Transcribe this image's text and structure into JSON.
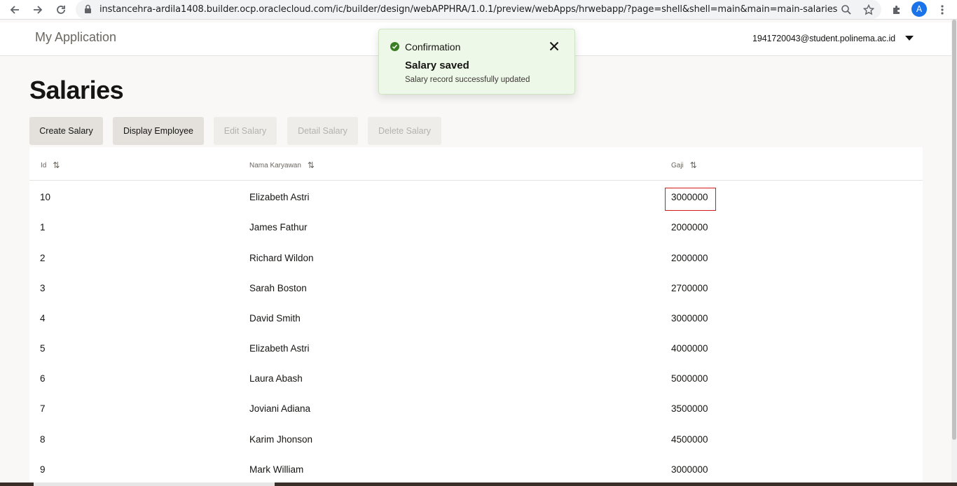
{
  "browser": {
    "url": "instancehra-ardila1408.builder.ocp.oraclecloud.com/ic/builder/design/webAPPHRA/1.0.1/preview/webApps/hrwebapp/?page=shell&shell=main&main=main-salaries",
    "profile_initial": "A"
  },
  "header": {
    "app_title": "My Application",
    "user_email": "1941720043@student.polinema.ac.id"
  },
  "page": {
    "title": "Salaries"
  },
  "toolbar": {
    "create_label": "Create Salary",
    "display_label": "Display Employee",
    "edit_label": "Edit Salary",
    "detail_label": "Detail Salary",
    "delete_label": "Delete Salary"
  },
  "table": {
    "columns": [
      "Id",
      "Nama Karyawan",
      "Gaji"
    ],
    "rows": [
      {
        "id": "10",
        "nama": "Elizabeth Astri",
        "gaji": "3000000"
      },
      {
        "id": "1",
        "nama": "James Fathur",
        "gaji": "2000000"
      },
      {
        "id": "2",
        "nama": "Richard Wildon",
        "gaji": "2000000"
      },
      {
        "id": "3",
        "nama": "Sarah Boston",
        "gaji": "2700000"
      },
      {
        "id": "4",
        "nama": "David Smith",
        "gaji": "3000000"
      },
      {
        "id": "5",
        "nama": "Elizabeth Astri",
        "gaji": "4000000"
      },
      {
        "id": "6",
        "nama": "Laura Abash",
        "gaji": "5000000"
      },
      {
        "id": "7",
        "nama": "Joviani Adiana",
        "gaji": "3500000"
      },
      {
        "id": "8",
        "nama": "Karim Jhonson",
        "gaji": "4500000"
      },
      {
        "id": "9",
        "nama": "Mark William",
        "gaji": "3000000"
      }
    ]
  },
  "toast": {
    "category": "Confirmation",
    "summary": "Salary saved",
    "detail": "Salary record successfully updated"
  },
  "colors": {
    "confirmation_green": "#3b7d23",
    "selection_border": "#d11a1a"
  }
}
